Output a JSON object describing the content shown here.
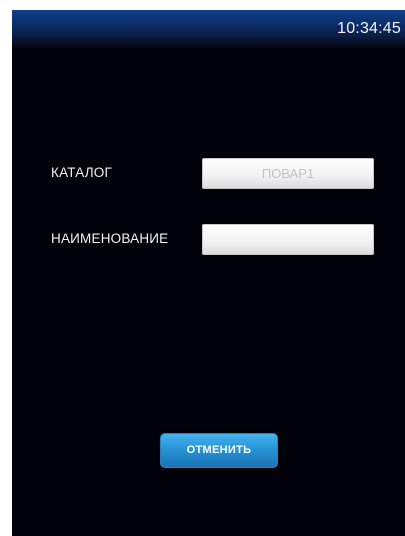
{
  "status_bar": {
    "time": "10:34:45"
  },
  "form": {
    "catalog_label": "КАТАЛОГ",
    "catalog_value": "ПОВАР1",
    "name_label": "НАИМЕНОВАНИЕ",
    "name_value": ""
  },
  "actions": {
    "cancel_label": "ОТМЕНИТЬ"
  },
  "colors": {
    "background": "#02020a",
    "status_bar_top": "#0f3d8c",
    "button_accent": "#2694d6"
  }
}
